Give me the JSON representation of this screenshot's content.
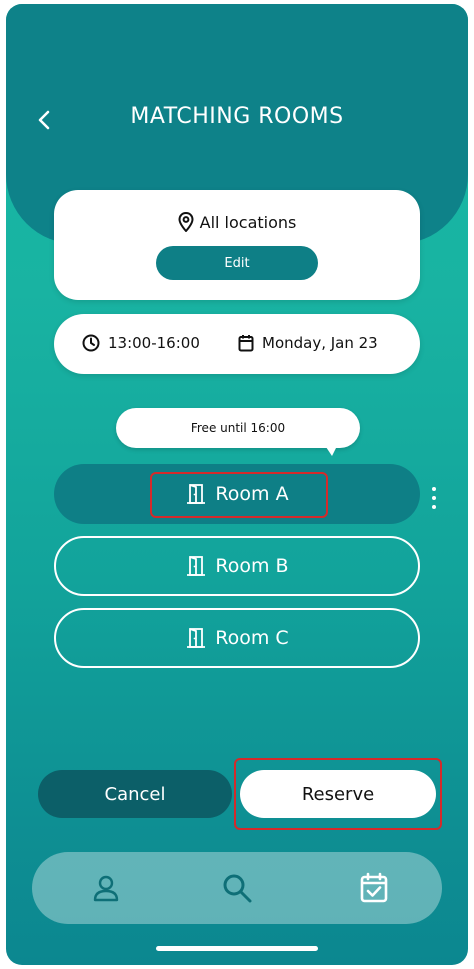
{
  "header": {
    "title": "MATCHING ROOMS"
  },
  "location": {
    "label": "All locations",
    "edit_label": "Edit"
  },
  "booking": {
    "time": "13:00-16:00",
    "date": "Monday, Jan 23"
  },
  "tooltip": {
    "text": "Free until 16:00"
  },
  "rooms": [
    {
      "label": "Room A",
      "selected": true
    },
    {
      "label": "Room B",
      "selected": false
    },
    {
      "label": "Room C",
      "selected": false
    }
  ],
  "actions": {
    "cancel_label": "Cancel",
    "reserve_label": "Reserve"
  },
  "nav": {
    "items": [
      {
        "icon": "user-icon"
      },
      {
        "icon": "search-icon",
        "active": true
      },
      {
        "icon": "calendar-check-icon"
      }
    ]
  },
  "colors": {
    "primary_dark": "#0e7f86",
    "header_bg": "#0e8289",
    "cancel_bg": "#0c5f68",
    "highlight": "#d42a2a"
  }
}
